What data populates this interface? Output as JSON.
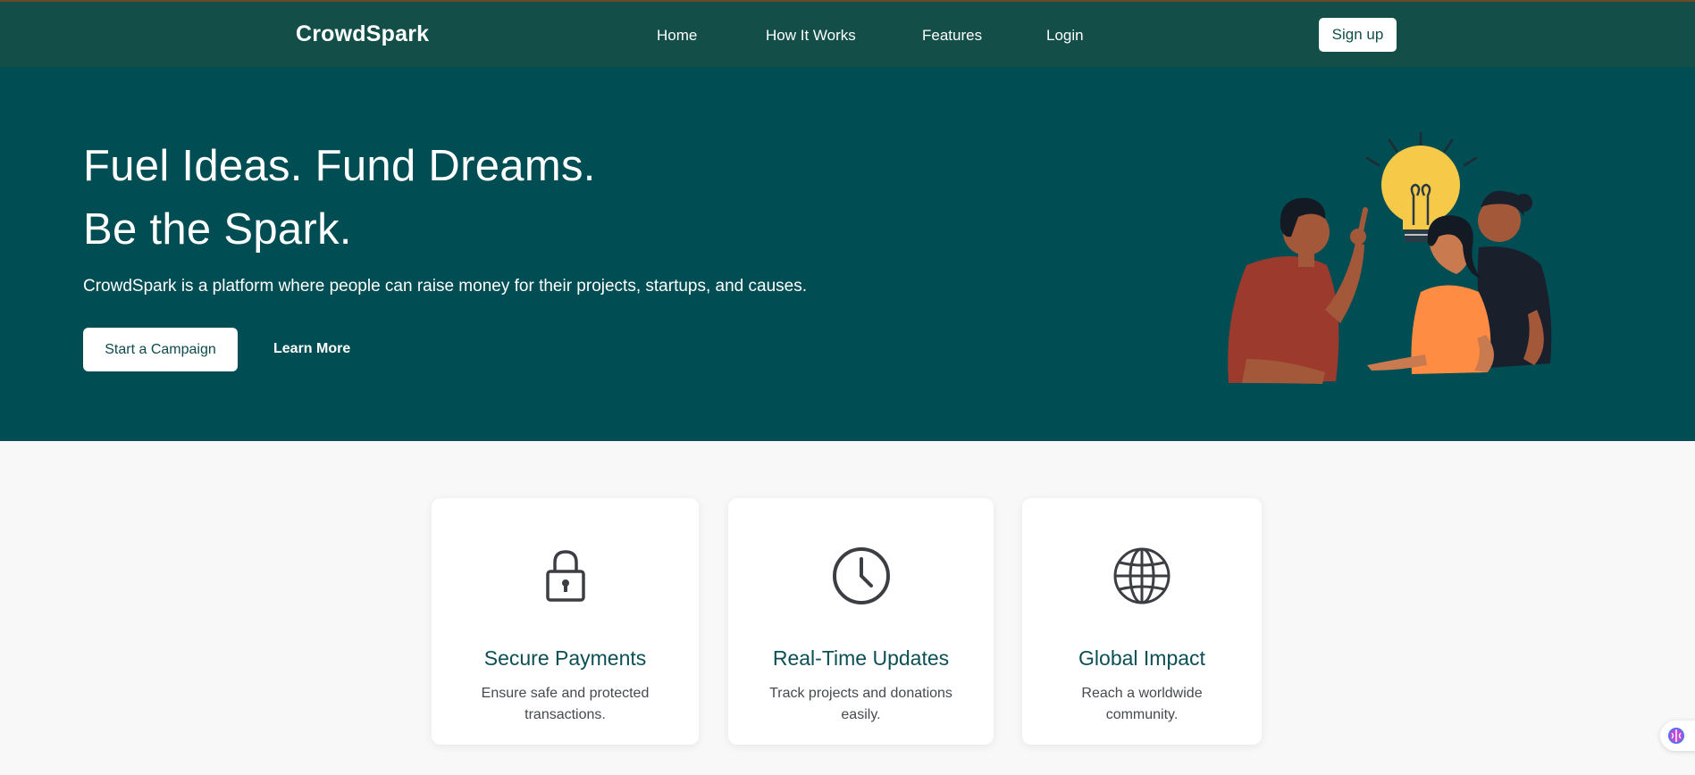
{
  "nav": {
    "brand": "CrowdSpark",
    "links": [
      "Home",
      "How It Works",
      "Features",
      "Login"
    ],
    "signup_label": "Sign up"
  },
  "hero": {
    "title_line1": "Fuel Ideas. Fund Dreams.",
    "title_line2": "Be the Spark.",
    "description": "CrowdSpark is a platform where people can raise money for their projects, startups, and causes.",
    "primary_button": "Start a Campaign",
    "secondary_button": "Learn More",
    "illustration": "three-people-lightbulb-illustration"
  },
  "features": [
    {
      "icon": "lock-icon",
      "title": "Secure Payments",
      "text": "Ensure safe and protected transactions."
    },
    {
      "icon": "clock-icon",
      "title": "Real-Time Updates",
      "text": "Track projects and donations easily."
    },
    {
      "icon": "globe-icon",
      "title": "Global Impact",
      "text": "Reach a worldwide community."
    }
  ],
  "floating_widget": {
    "icon": "brain-icon"
  },
  "colors": {
    "nav_bg": "#134e48",
    "hero_bg": "#004d54",
    "accent_text": "#0c4f55",
    "page_bg": "#f8f8f8"
  }
}
